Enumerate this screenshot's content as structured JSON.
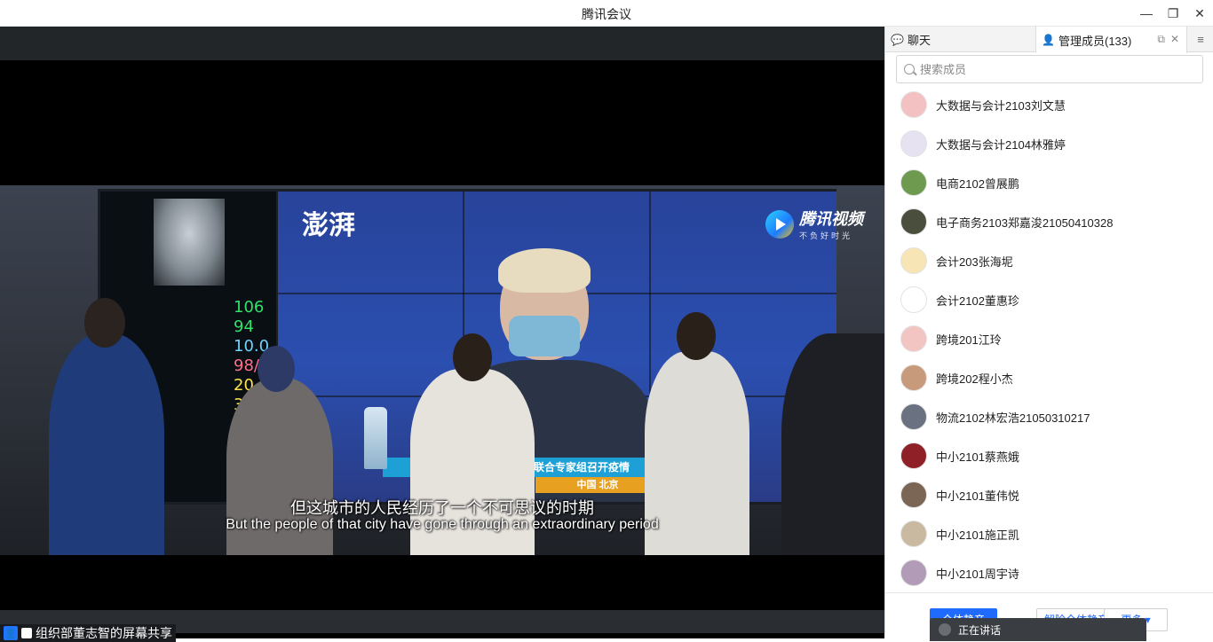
{
  "window": {
    "title": "腾讯会议",
    "controls": {
      "minimize": "—",
      "restore": "❐",
      "close": "✕"
    }
  },
  "video": {
    "logo_left": "澎湃",
    "logo_right": "腾讯视频",
    "logo_right_tagline": "不负好时光",
    "banner_text": "联合专家组召开疫情",
    "banner_location": "中国 北京",
    "vitals": [
      "106",
      "94",
      "10.0",
      "98/75",
      "20",
      "37.8"
    ],
    "subtitle_cn": "但这城市的人民经历了一个不可思议的时期",
    "subtitle_en": "But the people of that city have gone through an extraordinary period"
  },
  "speaking": {
    "label": "组织部董志智的屏幕共享"
  },
  "panel": {
    "tabs": [
      {
        "label": "聊天",
        "icon": "chat-icon"
      },
      {
        "label": "管理成员(133)",
        "icon": "person-icon"
      }
    ],
    "tab_tools": {
      "popout": "⧉",
      "close": "✕"
    },
    "menu": "≡",
    "search_placeholder": "搜索成员",
    "members": [
      {
        "name": "大数据与会计2103刘文慧",
        "color": "#f3c1c1"
      },
      {
        "name": "大数据与会计2104林雅婷",
        "color": "#e6e2f2"
      },
      {
        "name": "电商2102曾展鹏",
        "color": "#6d9a4f"
      },
      {
        "name": "电子商务2103郑嘉浚21050410328",
        "color": "#4a4f3d"
      },
      {
        "name": "会计203张海坭",
        "color": "#f7e5b6"
      },
      {
        "name": "会计2102董惠珍",
        "color": "#ffffff"
      },
      {
        "name": "跨境201江玲",
        "color": "#f2c5c2"
      },
      {
        "name": "跨境202程小杰",
        "color": "#c89a7c"
      },
      {
        "name": "物流2102林宏浩21050310217",
        "color": "#6a7181"
      },
      {
        "name": "中小2101蔡燕娥",
        "color": "#8f2027"
      },
      {
        "name": "中小2101董伟悦",
        "color": "#7b6656"
      },
      {
        "name": "中小2101施正凯",
        "color": "#c9b9a0"
      },
      {
        "name": "中小2101周宇诗",
        "color": "#b29bb6"
      }
    ],
    "footer": {
      "mute_all": "全体静音",
      "unmute_all": "解除全体静音",
      "more": "更多 ▾",
      "toast": "正在讲话"
    }
  },
  "colors": {
    "accent": "#1f6bff",
    "stage_bg": "#232629",
    "panel_bg": "#ffffff"
  }
}
